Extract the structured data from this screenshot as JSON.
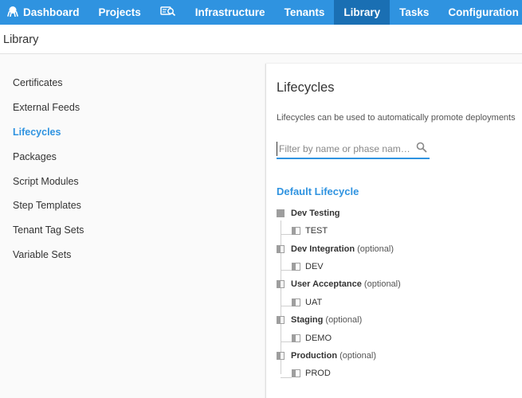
{
  "nav": {
    "items": [
      {
        "label": "Dashboard",
        "icon": "octopus-logo-icon"
      },
      {
        "label": "Projects"
      },
      {
        "label": "",
        "icon": "machines-search-icon"
      },
      {
        "label": "Infrastructure"
      },
      {
        "label": "Tenants"
      },
      {
        "label": "Library",
        "active": true
      },
      {
        "label": "Tasks"
      },
      {
        "label": "Configuration"
      }
    ]
  },
  "page": {
    "title": "Library"
  },
  "sidebar": {
    "items": [
      {
        "label": "Certificates"
      },
      {
        "label": "External Feeds"
      },
      {
        "label": "Lifecycles",
        "active": true
      },
      {
        "label": "Packages"
      },
      {
        "label": "Script Modules"
      },
      {
        "label": "Step Templates"
      },
      {
        "label": "Tenant Tag Sets"
      },
      {
        "label": "Variable Sets"
      }
    ]
  },
  "main": {
    "title": "Lifecycles",
    "description": "Lifecycles can be used to automatically promote deployments",
    "filter": {
      "placeholder": "Filter by name or phase nam…",
      "value": ""
    },
    "lifecycle": {
      "name": "Default Lifecycle",
      "phases": [
        {
          "name": "Dev Testing",
          "optional": "",
          "env": "TEST"
        },
        {
          "name": "Dev Integration",
          "optional": "(optional)",
          "env": "DEV"
        },
        {
          "name": "User Acceptance",
          "optional": "(optional)",
          "env": "UAT"
        },
        {
          "name": "Staging",
          "optional": "(optional)",
          "env": "DEMO"
        },
        {
          "name": "Production",
          "optional": "(optional)",
          "env": "PROD"
        }
      ]
    }
  },
  "colors": {
    "accent": "#2f93e0",
    "nav_active": "#1a6fb3",
    "box_gray": "#9e9e9e"
  }
}
